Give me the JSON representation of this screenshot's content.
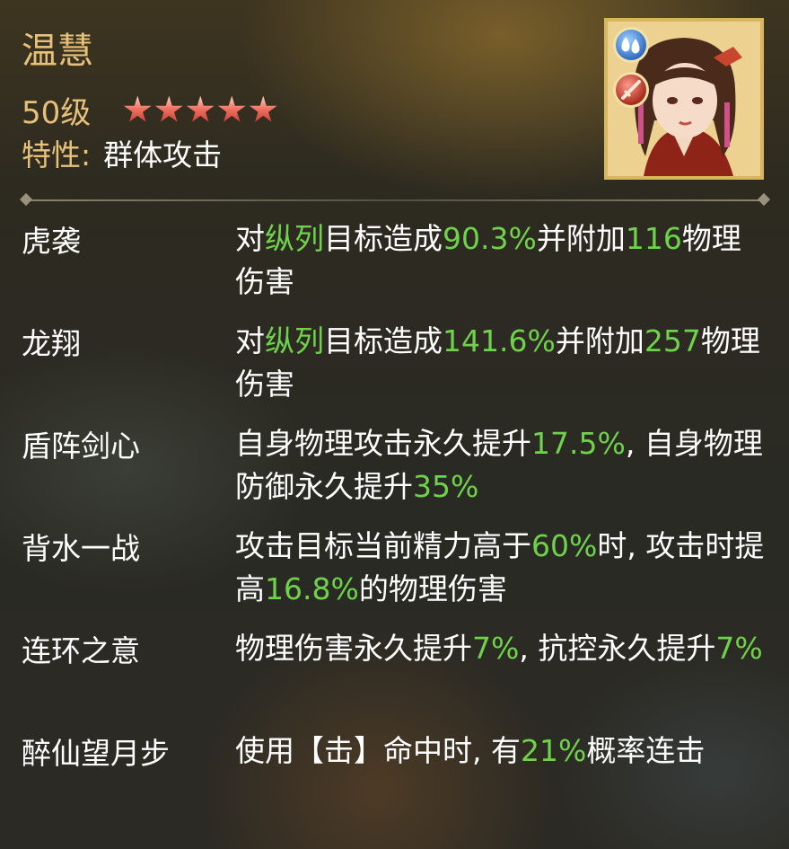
{
  "hero": {
    "name": "温慧",
    "level": "50级",
    "stars": 5,
    "trait_label": "特性:",
    "trait_value": "群体攻击",
    "portrait_icon": "hero-portrait-icon",
    "badge_icons": [
      "water-element-icon",
      "sword-class-icon"
    ]
  },
  "colors": {
    "gold": "#e7c07a",
    "white": "#ffffff",
    "highlight_green": "#6ed24a",
    "star_red": "#f07060"
  },
  "skills": [
    {
      "name": "虎袭",
      "desc": [
        {
          "t": "对"
        },
        {
          "t": "纵列",
          "hl": true
        },
        {
          "t": "目标造成"
        },
        {
          "t": "90.3%",
          "hl": true
        },
        {
          "t": "并附加"
        },
        {
          "t": "116",
          "hl": true
        },
        {
          "t": "物理伤害"
        }
      ]
    },
    {
      "name": "龙翔",
      "desc": [
        {
          "t": "对"
        },
        {
          "t": "纵列",
          "hl": true
        },
        {
          "t": "目标造成"
        },
        {
          "t": "141.6%",
          "hl": true
        },
        {
          "t": "并附加"
        },
        {
          "t": "257",
          "hl": true
        },
        {
          "t": "物理伤害"
        }
      ]
    },
    {
      "name": "盾阵剑心",
      "desc": [
        {
          "t": "自身物理攻击永久提升"
        },
        {
          "t": "17.5%",
          "hl": true
        },
        {
          "t": ", 自身物理防御永久提升"
        },
        {
          "t": "35%",
          "hl": true
        }
      ]
    },
    {
      "name": "背水一战",
      "desc": [
        {
          "t": "攻击目标当前精力高于"
        },
        {
          "t": "60%",
          "hl": true
        },
        {
          "t": "时, 攻击时提高"
        },
        {
          "t": "16.8%",
          "hl": true
        },
        {
          "t": "的物理伤害"
        }
      ]
    },
    {
      "name": "连环之意",
      "desc": [
        {
          "t": "物理伤害永久提升"
        },
        {
          "t": "7%",
          "hl": true
        },
        {
          "t": ", 抗控永久提升"
        },
        {
          "t": "7%",
          "hl": true
        }
      ]
    },
    {
      "name": "醉仙望月步",
      "desc": [
        {
          "t": "使用【击】命中时, 有"
        },
        {
          "t": "21%",
          "hl": true
        },
        {
          "t": "概率连击"
        }
      ]
    }
  ]
}
